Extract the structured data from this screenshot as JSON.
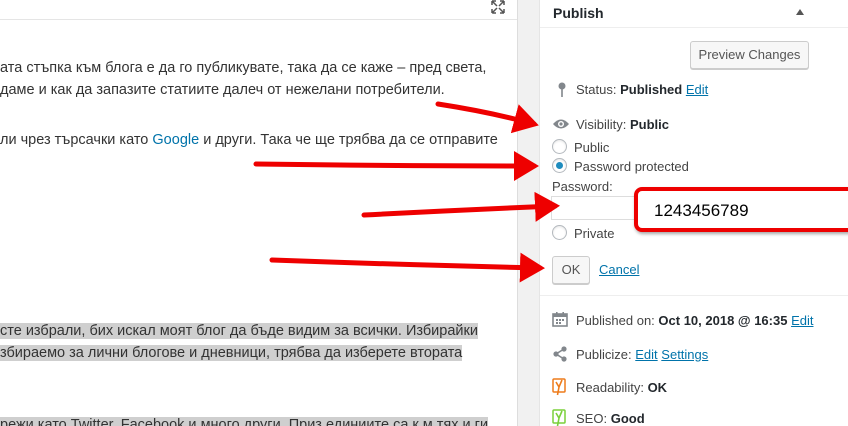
{
  "editor": {
    "paragraphs": [
      "ата стъпка към блога е да го публикувате, така да се каже – пред света,",
      "даме и как да запазите статиите далеч от нежелани потребители.",
      "ли чрез търсачки като ",
      "Google",
      " и други. Така че ще трябва да се отправите",
      "сте избрали, бих искал моят блог да бъде видим за всички. Избирайки",
      "збираемо за лични блогове и дневници, трябва да изберете втората",
      "режи като Twitter, Facebook и много други. Приз единиите са к м тях и ги"
    ]
  },
  "publish": {
    "title": "Publish",
    "preview_label": "Preview Changes",
    "status_label": "Status:",
    "status_value": "Published",
    "status_edit": "Edit",
    "visibility_label": "Visibility:",
    "visibility_value": "Public",
    "options": {
      "public": "Public",
      "password": "Password protected",
      "private": "Private"
    },
    "password_label": "Password:",
    "password_value": "",
    "ok_label": "OK",
    "cancel_label": "Cancel",
    "published_label": "Published on:",
    "published_value": "Oct 10, 2018 @ 16:35",
    "published_edit": "Edit",
    "publicize_label": "Publicize:",
    "publicize_edit": "Edit",
    "publicize_settings": "Settings",
    "readability_label": "Readability:",
    "readability_value": "OK",
    "seo_label": "SEO:",
    "seo_value": "Good"
  },
  "annotation": {
    "callout_text": "1243456789",
    "color": "#e00000"
  },
  "colors": {
    "link": "#0073aa",
    "radio_checked": "#1e8cbe",
    "yoast_orange": "#ee7c1b",
    "yoast_green": "#7ad03a"
  }
}
